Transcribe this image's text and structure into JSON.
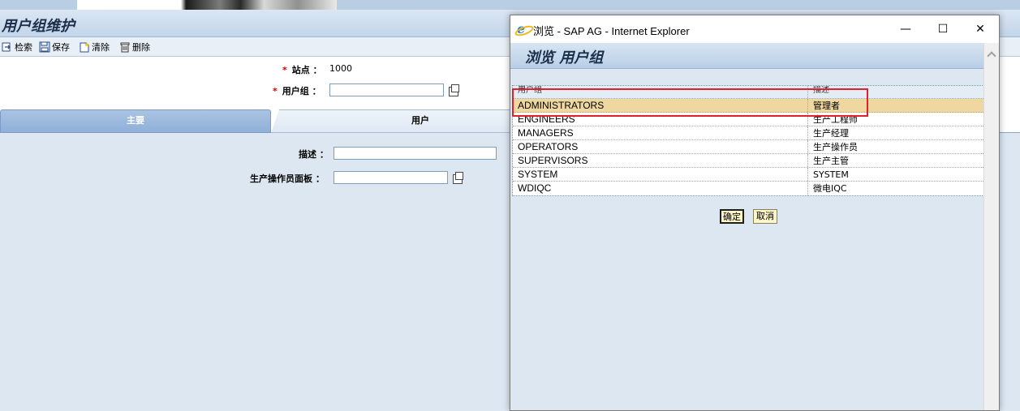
{
  "app": {
    "title": "用户组维护",
    "toolbar": {
      "retrieve": "检索",
      "save": "保存",
      "clear": "清除",
      "delete": "删除"
    },
    "form": {
      "site_label": "站点 ：",
      "site_value": "1000",
      "user_group_label": "用户组 ：",
      "required_mark": "*",
      "description_label": "描述 ：",
      "panel_label": "生产操作员面板 ："
    },
    "tabs": {
      "main": "主要",
      "user": "用户"
    }
  },
  "popup": {
    "window_title": "浏览 - SAP AG - Internet Explorer",
    "heading": "浏览  用户组",
    "window_buttons": {
      "minimize": "—",
      "maximize": "☐",
      "close": "✕"
    },
    "columns": [
      "用户组",
      "描述"
    ],
    "rows": [
      {
        "group": "ADMINISTRATORS",
        "desc": "管理者",
        "selected": true
      },
      {
        "group": "ENGINEERS",
        "desc": "生产工程师"
      },
      {
        "group": "MANAGERS",
        "desc": "生产经理"
      },
      {
        "group": "OPERATORS",
        "desc": "生产操作员"
      },
      {
        "group": "SUPERVISORS",
        "desc": "生产主管"
      },
      {
        "group": "SYSTEM",
        "desc": "SYSTEM"
      },
      {
        "group": "WDIQC",
        "desc": "微电IQC"
      }
    ],
    "ok_button": "确定",
    "cancel_button": "取消"
  },
  "colors": {
    "selected_row": "#efd8a0",
    "highlight_box": "#e0202a",
    "tab_active": "#8fb0d8",
    "background": "#dce7f2"
  }
}
